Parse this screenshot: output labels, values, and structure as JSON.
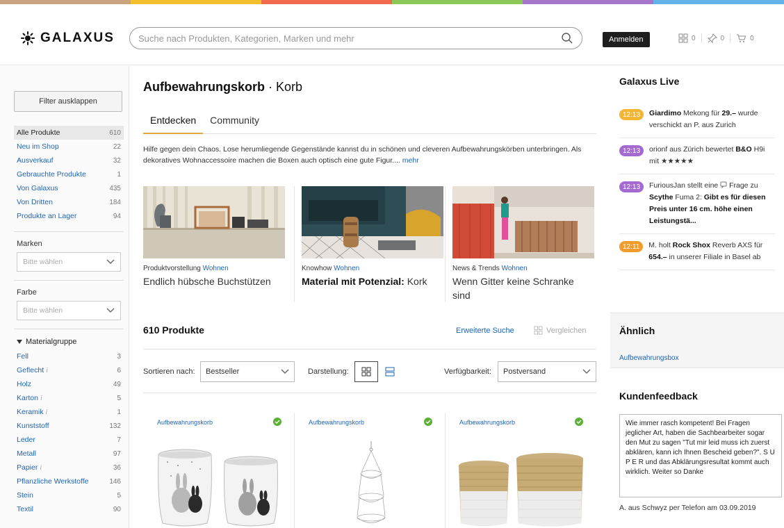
{
  "colors": {
    "rainbow": [
      "#c9a47e",
      "#f5c02e",
      "#ef6a4f",
      "#8bc857",
      "#a875cc",
      "#63b2e8"
    ],
    "link": "#1d64b4",
    "tab_underline": "#e2a83a",
    "time_yellow": "#f2b632",
    "time_purple": "#a56ad2",
    "time_orange": "#f29c2b",
    "check_green": "#5bb035"
  },
  "header": {
    "logo_text": "GALAXUS",
    "logo_icon": "galaxy-star-icon",
    "search_placeholder": "Suche nach Produkten, Kategorien, Marken und mehr",
    "login_label": "Anmelden",
    "compare_count": "0",
    "wishlist_count": "0",
    "cart_count": "0"
  },
  "sidebar": {
    "filter_button": "Filter ausklappen",
    "categories": [
      {
        "label": "Alle Produkte",
        "count": "610",
        "active": true
      },
      {
        "label": "Neu im Shop",
        "count": "22"
      },
      {
        "label": "Ausverkauf",
        "count": "32"
      },
      {
        "label": "Gebrauchte Produkte",
        "count": "1"
      },
      {
        "label": "Von Galaxus",
        "count": "435"
      },
      {
        "label": "Von Dritten",
        "count": "184"
      },
      {
        "label": "Produkte an Lager",
        "count": "94"
      }
    ],
    "brands_label": "Marken",
    "brands_placeholder": "Bitte wählen",
    "color_label": "Farbe",
    "color_placeholder": "Bitte wählen",
    "material_group_label": "Materialgruppe",
    "materials": [
      {
        "label": "Fell",
        "count": "3"
      },
      {
        "label": "Geflecht",
        "count": "6",
        "info": "i"
      },
      {
        "label": "Holz",
        "count": "49"
      },
      {
        "label": "Karton",
        "count": "5",
        "info": "i"
      },
      {
        "label": "Keramik",
        "count": "1",
        "info": "i"
      },
      {
        "label": "Kunststoff",
        "count": "132"
      },
      {
        "label": "Leder",
        "count": "7"
      },
      {
        "label": "Metall",
        "count": "97"
      },
      {
        "label": "Papier",
        "count": "36",
        "info": "i"
      },
      {
        "label": "Pflanzliche Werkstoffe",
        "count": "146"
      },
      {
        "label": "Stein",
        "count": "5"
      },
      {
        "label": "Textil",
        "count": "90"
      }
    ]
  },
  "main": {
    "title_bold": "Aufbewahrungskorb",
    "title_rest": " · Korb",
    "tabs": [
      "Entdecken",
      "Community"
    ],
    "description": "Hilfe gegen dein Chaos. Lose herumliegende Gegenstände kannst du in schönen und cleveren Aufbewahrungskörben unterbringen. Als dekoratives Wohnaccessoire machen die Boxen auch optisch eine gute Figur.... ",
    "description_more": "mehr",
    "articles": [
      {
        "type": "Produktvorstellung",
        "category": "Wohnen",
        "title_bold": "",
        "title": "Endlich hübsche Buchstützen"
      },
      {
        "type": "Knowhow",
        "category": "Wohnen",
        "title_bold": "Material mit Potenzial:",
        "title": " Kork"
      },
      {
        "type": "News & Trends",
        "category": "Wohnen",
        "title_bold": "",
        "title": "Wenn Gitter keine Schranke sind"
      }
    ],
    "product_count": "610 Produkte",
    "advanced_search": "Erweiterte Suche",
    "compare": "Vergleichen",
    "sort_label": "Sortieren nach:",
    "sort_value": "Bestseller",
    "view_label": "Darstellung:",
    "availability_label": "Verfügbarkeit:",
    "availability_value": "Postversand",
    "products": [
      {
        "category": "Aufbewahrungskorb"
      },
      {
        "category": "Aufbewahrungskorb"
      },
      {
        "category": "Aufbewahrungskorb"
      }
    ]
  },
  "right": {
    "live_title": "Galaxus Live",
    "live_items": [
      {
        "time": "12:13",
        "color": "yellow",
        "user": "Giardimo",
        "text1": " Mekong für ",
        "bold2": "29.–",
        "text2": " wurde verschickt an P. aus Zurich"
      },
      {
        "time": "12:13",
        "color": "purple",
        "user": "",
        "text1": "orionf aus Zürich bewertet ",
        "bold2": "B&O",
        "text2": " H9i mit ★★★★★"
      },
      {
        "time": "12:13",
        "color": "purple",
        "user": "",
        "text1": "FuriousJan stellt eine ",
        "bold2": "",
        "text2": "Frage zu ",
        "bold3": "Scythe",
        "text3": " Fuma 2: ",
        "bold4": "Gibt es für diesen Preis unter 16 cm. höhe einen Leistungstä..."
      },
      {
        "time": "12:11",
        "color": "orange",
        "user": "",
        "text1": "M. holt ",
        "bold2": "Rock Shox",
        "text2": " Reverb AXS für ",
        "bold3": "654.–",
        "text3": " in unserer Filiale in Basel ab"
      }
    ],
    "similar_title": "Ähnlich",
    "similar_link": "Aufbewahrungsbox",
    "feedback_title": "Kundenfeedback",
    "feedback_text": "Wie immer rasch kompetent! Bei Fragen jeglicher Art, haben die Sachbearbeiter sogar den Mut zu sagen \"Tut mir leid muss ich zuerst abklären, kann ich Ihnen Bescheid geben?\". S U P E R und das Abklärungsresultat kommt auch wirklich. Weiter so Danke",
    "feedback_author": "A. aus Schwyz per Telefon am 03.09.2019"
  }
}
